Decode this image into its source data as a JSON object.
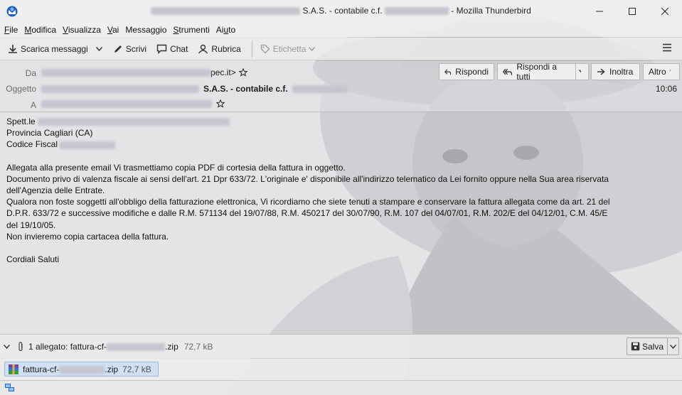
{
  "window": {
    "title_prefix_hidden": true,
    "title_mid": "S.A.S. - contabile c.f.",
    "title_suffix": "- Mozilla Thunderbird"
  },
  "menu": [
    "File",
    "Modifica",
    "Visualizza",
    "Vai",
    "Messaggio",
    "Strumenti",
    "Aiuto"
  ],
  "menu_mnemonics": [
    "F",
    "M",
    "V",
    "V",
    "g",
    "S",
    "u"
  ],
  "toolbar": {
    "get_messages": "Scarica messaggi",
    "write": "Scrivi",
    "chat": "Chat",
    "address_book": "Rubrica",
    "tag": "Etichetta"
  },
  "header": {
    "from_label": "Da",
    "from_domain": "pec.it>",
    "subject_label": "Oggetto",
    "subject_text": "S.A.S. - contabile c.f.",
    "to_label": "A",
    "time": "10:06",
    "reply": "Rispondi",
    "reply_all": "Rispondi a tutti",
    "forward": "Inoltra",
    "other": "Altro"
  },
  "body": {
    "greeting": "Spett.le",
    "province": "Provincia Cagliari (CA)",
    "tax_code_label": "Codice Fiscal",
    "p1": "Allegata alla presente email Vi trasmettiamo copia PDF di cortesia della fattura in oggetto.",
    "p2": "Documento privo di valenza fiscale ai sensi dell'art. 21 Dpr 633/72. L'originale e' disponibile all'indirizzo telematico da Lei fornito oppure nella Sua area riservata",
    "p3": "dell'Agenzia delle Entrate.",
    "p4": "Qualora non foste soggetti all'obbligo della fatturazione elettronica, Vi ricordiamo che siete tenuti a stampare e conservare la fattura allegata come da art. 21 del",
    "p5": "D.P.R. 633/72 e successive modifiche e dalle R.M. 571134 del 19/07/88, R.M. 450217 del 30/07/90, R.M. 107 del 04/07/01, R.M. 202/E del 04/12/01, C.M. 45/E",
    "p6": "del 19/10/05.",
    "p7": "Non invieremo copia cartacea della fattura.",
    "closing": "Cordiali Saluti"
  },
  "attachments": {
    "summary_prefix": "1 allegato: fattura-cf-",
    "summary_suffix": ".zip",
    "summary_size": "72,7 kB",
    "save": "Salva",
    "item_prefix": "fattura-cf-",
    "item_suffix": ".zip",
    "item_size": "72,7 kB"
  },
  "colors": {
    "selected_attachment_bg": "#cfe0f3",
    "redaction": "#c5c5cf"
  }
}
